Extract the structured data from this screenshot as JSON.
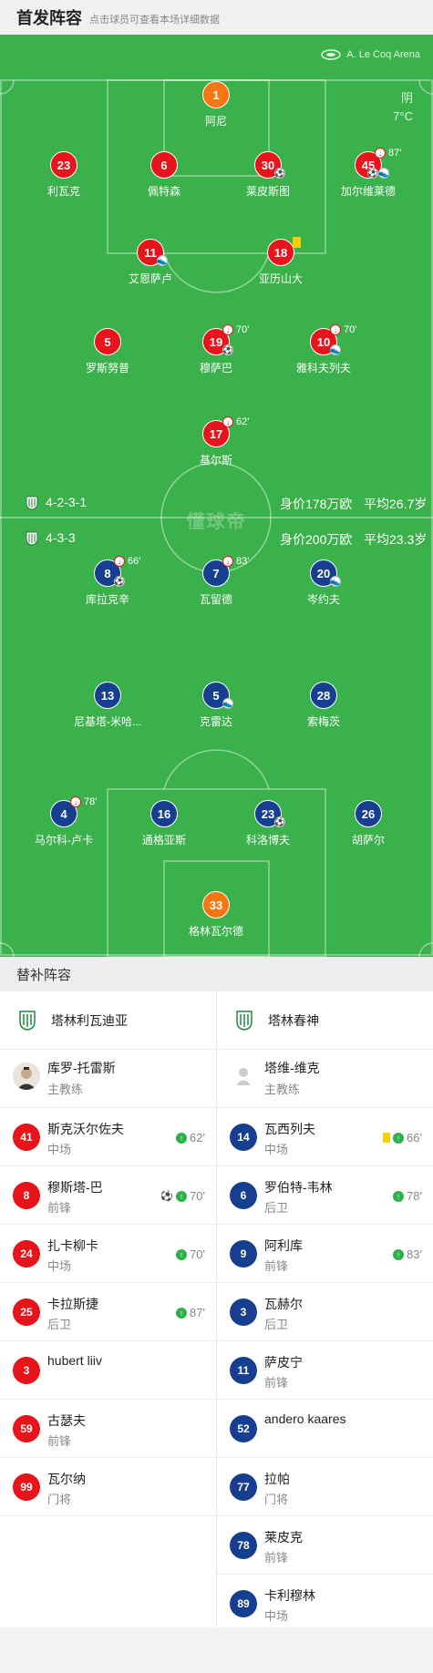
{
  "header": {
    "title": "首发阵容",
    "subtitle": "点击球员可查看本场详细数据"
  },
  "pitch": {
    "stadium": "A. Le Coq Arena",
    "weather": "阴",
    "temperature": "7°C",
    "watermark": "懂球帝",
    "home_info": {
      "formation": "4-2-3-1",
      "value": "身价178万欧",
      "avg_age": "平均26.7岁"
    },
    "away_info": {
      "formation": "4-3-3",
      "value": "身价200万欧",
      "avg_age": "平均23.3岁"
    }
  },
  "home_players": [
    {
      "num": "1",
      "name": "阿尼",
      "gk": true
    },
    {
      "num": "23",
      "name": "利瓦克"
    },
    {
      "num": "6",
      "name": "佩特森"
    },
    {
      "num": "30",
      "name": "莱皮斯图",
      "events": [
        "goal"
      ]
    },
    {
      "num": "45",
      "name": "加尔维莱德",
      "sub_min": "87'",
      "events": [
        "goal",
        "assist"
      ]
    },
    {
      "num": "11",
      "name": "艾恩萨卢",
      "events": [
        "assist"
      ]
    },
    {
      "num": "18",
      "name": "亚历山大",
      "card": "yellow"
    },
    {
      "num": "5",
      "name": "罗斯努普"
    },
    {
      "num": "19",
      "name": "穆萨巴",
      "sub_min": "70'",
      "events": [
        "goal"
      ]
    },
    {
      "num": "10",
      "name": "雅科夫列夫",
      "sub_min": "70'",
      "events": [
        "assist"
      ]
    },
    {
      "num": "17",
      "name": "基尔斯",
      "sub_min": "62'"
    }
  ],
  "away_players": [
    {
      "num": "8",
      "name": "库拉克辛",
      "sub_min": "66'",
      "events": [
        "goal"
      ]
    },
    {
      "num": "7",
      "name": "瓦留德",
      "sub_min": "83'"
    },
    {
      "num": "20",
      "name": "岑约夫",
      "events": [
        "assist"
      ]
    },
    {
      "num": "13",
      "name": "尼基塔-米哈..."
    },
    {
      "num": "5",
      "name": "克雷达",
      "events": [
        "assist"
      ]
    },
    {
      "num": "28",
      "name": "索梅茨"
    },
    {
      "num": "4",
      "name": "马尔科-卢卡",
      "sub_min": "78'"
    },
    {
      "num": "16",
      "name": "通格亚斯"
    },
    {
      "num": "23",
      "name": "科洛博夫",
      "events": [
        "goal"
      ]
    },
    {
      "num": "26",
      "name": "胡萨尔"
    },
    {
      "num": "33",
      "name": "格林瓦尔德",
      "gk": true
    }
  ],
  "subs_section": {
    "title": "替补阵容",
    "home": {
      "team": "塔林利瓦迪亚",
      "coach": {
        "name": "库罗-托雷斯",
        "role": "主教练"
      },
      "players": [
        {
          "num": "41",
          "name": "斯克沃尔佐夫",
          "pos": "中场",
          "in_min": "62'"
        },
        {
          "num": "8",
          "name": "穆斯塔-巴",
          "pos": "前锋",
          "in_min": "70'",
          "goal": true
        },
        {
          "num": "24",
          "name": "扎卡柳卡",
          "pos": "中场",
          "in_min": "70'"
        },
        {
          "num": "25",
          "name": "卡拉斯捷",
          "pos": "后卫",
          "in_min": "87'"
        },
        {
          "num": "3",
          "name": "hubert liiv",
          "pos": ""
        },
        {
          "num": "59",
          "name": "古瑟夫",
          "pos": "前锋"
        },
        {
          "num": "99",
          "name": "瓦尔纳",
          "pos": "门将"
        }
      ]
    },
    "away": {
      "team": "塔林春神",
      "coach": {
        "name": "塔维-维克",
        "role": "主教练"
      },
      "players": [
        {
          "num": "14",
          "name": "瓦西列夫",
          "pos": "中场",
          "in_min": "66'",
          "yellow": true
        },
        {
          "num": "6",
          "name": "罗伯特-韦林",
          "pos": "后卫",
          "in_min": "78'"
        },
        {
          "num": "9",
          "name": "阿利库",
          "pos": "前锋",
          "in_min": "83'"
        },
        {
          "num": "3",
          "name": "瓦赫尔",
          "pos": "后卫"
        },
        {
          "num": "11",
          "name": "萨皮宁",
          "pos": "前锋"
        },
        {
          "num": "52",
          "name": "andero kaares",
          "pos": ""
        },
        {
          "num": "77",
          "name": "拉帕",
          "pos": "门将"
        },
        {
          "num": "78",
          "name": "莱皮克",
          "pos": "前锋"
        },
        {
          "num": "89",
          "name": "卡利穆林",
          "pos": "中场"
        }
      ]
    }
  }
}
